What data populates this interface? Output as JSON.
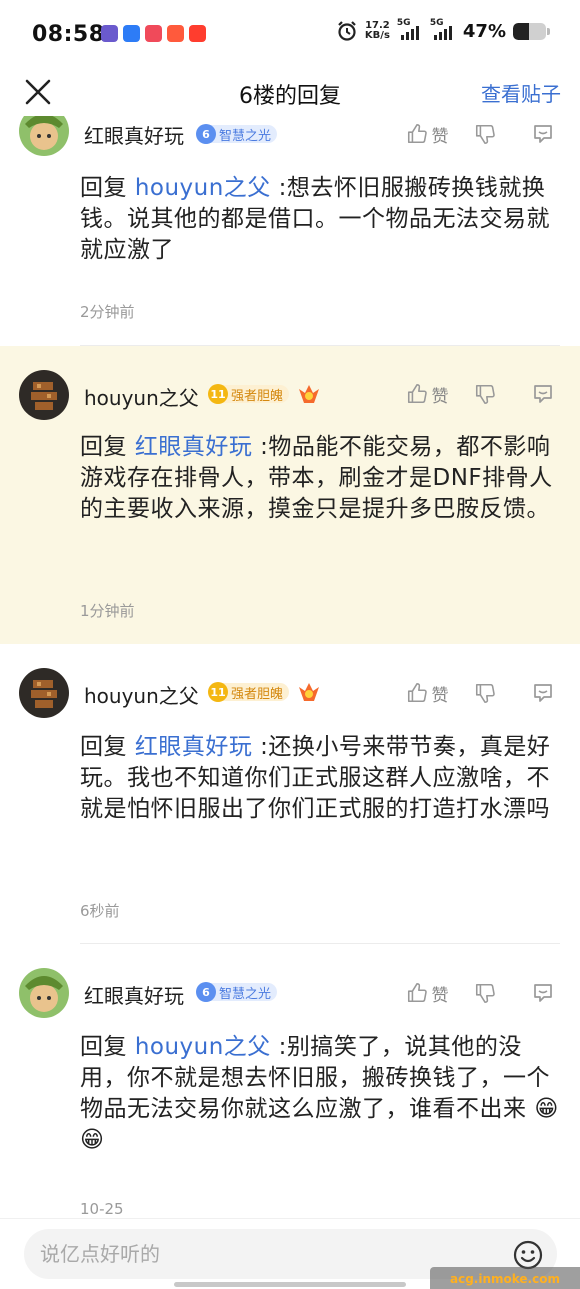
{
  "status_bar": {
    "time": "08:58",
    "net_speed_value": "17.2",
    "net_speed_unit": "KB/s",
    "sim1": "5G",
    "sim2": "5G",
    "battery_text": "47%",
    "battery_level": 0.47
  },
  "header": {
    "title": "6楼的回复",
    "view_post": "查看贴子"
  },
  "like_label": "赞",
  "comments": [
    {
      "username": "红眼真好玩",
      "level": "6",
      "title": "智慧之光",
      "reply_prefix": "回复",
      "reply_to": "houyun之父",
      "text": ":想去怀旧服搬砖换钱就换钱。说其他的都是借口。一个物品无法交易就就应激了",
      "time": "2分钟前"
    },
    {
      "username": "houyun之父",
      "level": "11",
      "title": "强者胆魄",
      "reply_prefix": "回复",
      "reply_to": "红眼真好玩",
      "text": ":物品能不能交易，都不影响游戏存在排骨人，带本，刷金才是DNF排骨人的主要收入来源，摸金只是提升多巴胺反馈。",
      "time": "1分钟前"
    },
    {
      "username": "houyun之父",
      "level": "11",
      "title": "强者胆魄",
      "reply_prefix": "回复",
      "reply_to": "红眼真好玩",
      "text": ":还换小号来带节奏，真是好玩。我也不知道你们正式服这群人应激啥，不就是怕怀旧服出了你们正式服的打造打水漂吗",
      "time": "6秒前"
    },
    {
      "username": "红眼真好玩",
      "level": "6",
      "title": "智慧之光",
      "reply_prefix": "回复",
      "reply_to": "houyun之父",
      "text": ":别搞笑了，说其他的没用，你不就是想去怀旧服，搬砖换钱了，一个物品无法交易你就这么应激了，谁看不出来",
      "emoji": "😁 😁",
      "time": "10-25"
    }
  ],
  "bottom": {
    "input_placeholder": "说亿点好听的",
    "watermark": "acg.inmoke.com"
  }
}
